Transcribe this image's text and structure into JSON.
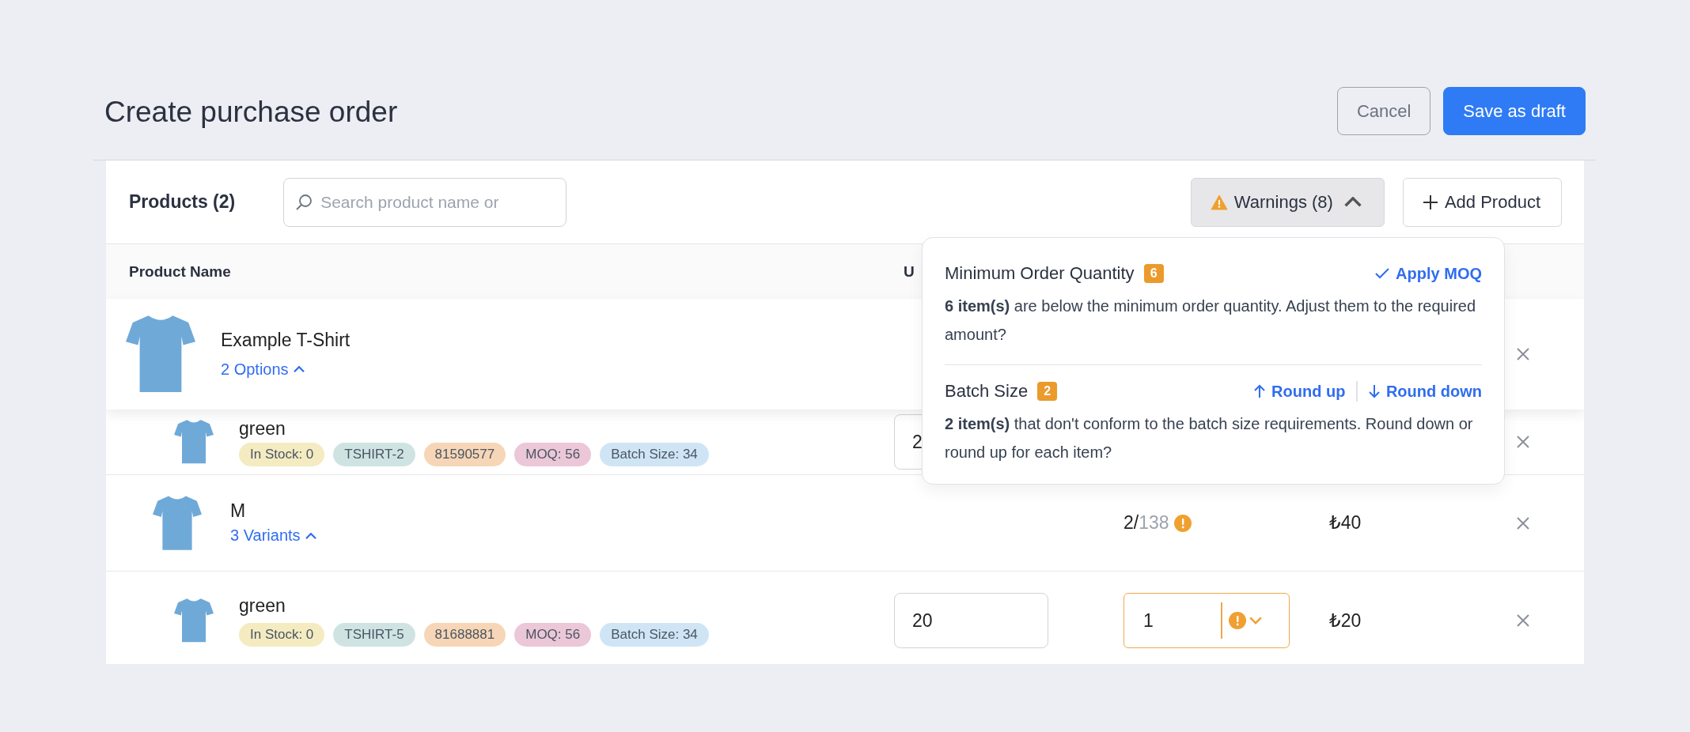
{
  "title": "Create purchase order",
  "header_buttons": [
    {
      "label": "Cancel",
      "kind": "secondary"
    },
    {
      "label": "Save as draft",
      "kind": "primary"
    }
  ],
  "products": {
    "title": "Products (2)",
    "search": {
      "placeholder": "Search product name or"
    },
    "warnings_button": {
      "label": "Warnings (8)",
      "expanded": true
    },
    "add_button": {
      "label": "Add Product"
    }
  },
  "table": {
    "columns": [
      "Product Name",
      "U"
    ],
    "rows": [
      {
        "kind": "product",
        "name": "Example T-Shirt",
        "toggle": "2 Options",
        "expanded": true
      },
      {
        "kind": "variant",
        "name": "green",
        "tags": [
          {
            "label": "In Stock: 0",
            "color": "#f4ebc1"
          },
          {
            "label": "TSHIRT-2",
            "color": "#cfe4e2"
          },
          {
            "label": "81590577",
            "color": "#f6d6b6"
          },
          {
            "label": "MOQ: 56",
            "color": "#ebc7d7"
          },
          {
            "label": "Batch Size: 34",
            "color": "#cfe5f6"
          }
        ],
        "quantity": "2"
      },
      {
        "kind": "option",
        "name": "M",
        "toggle": "3 Variants",
        "expanded": true,
        "ordered": "2/",
        "total": "138",
        "warning": true,
        "price": "₺40"
      },
      {
        "kind": "variant",
        "name": "green",
        "tags": [
          {
            "label": "In Stock: 0",
            "color": "#f4ebc1"
          },
          {
            "label": "TSHIRT-5",
            "color": "#cfe4e2"
          },
          {
            "label": "81688881",
            "color": "#f6d6b6"
          },
          {
            "label": "MOQ: 56",
            "color": "#ebc7d7"
          },
          {
            "label": "Batch Size: 34",
            "color": "#cfe5f6"
          }
        ],
        "quantity": "20",
        "batch": "1",
        "warning": true,
        "price": "₺20"
      }
    ]
  },
  "warnings_panel": {
    "sections": [
      {
        "title": "Minimum Order Quantity",
        "count": "6",
        "actions": [
          {
            "label": "Apply MOQ",
            "kind": "check"
          }
        ],
        "text": "**6 item(s)** are below the minimum order quantity. Adjust them to the required amount?"
      },
      {
        "title": "Batch Size",
        "count": "2",
        "actions": [
          {
            "label": "Round up",
            "kind": "up"
          },
          {
            "label": "Round down",
            "kind": "down"
          }
        ],
        "text": "**2 item(s)** that don't conform to the batch size requirements. Round down or round up for each item?"
      }
    ]
  }
}
